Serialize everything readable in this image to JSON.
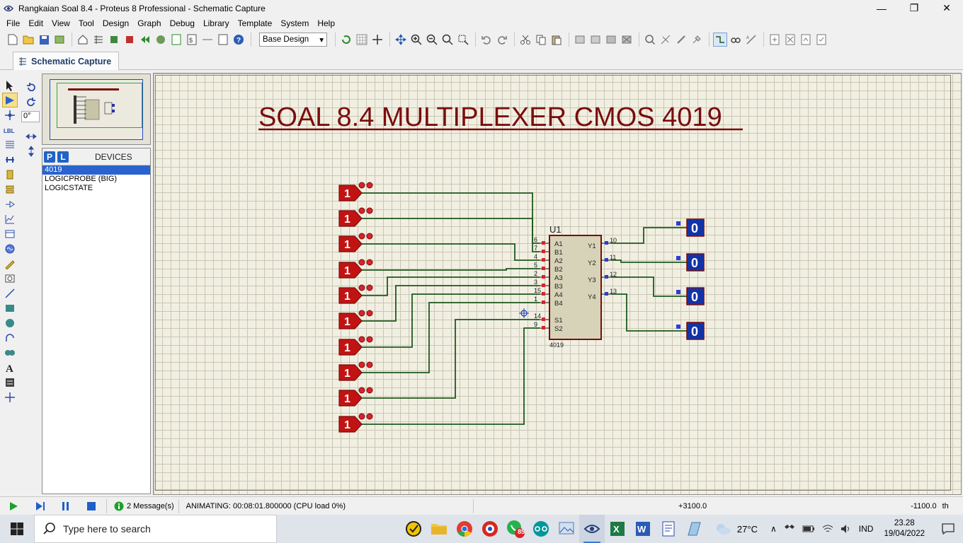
{
  "window": {
    "title": "Rangkaian Soal 8.4 - Proteus 8 Professional - Schematic Capture",
    "minimize": "—",
    "maximize": "❐",
    "close": "✕"
  },
  "menu": [
    "File",
    "Edit",
    "View",
    "Tool",
    "Design",
    "Graph",
    "Debug",
    "Library",
    "Template",
    "System",
    "Help"
  ],
  "toolbar": {
    "design_select": "Base Design"
  },
  "tab": {
    "label": "Schematic Capture"
  },
  "left_panel": {
    "angle": "0°",
    "devices_title": "DEVICES",
    "p_label": "P",
    "l_label": "L",
    "devices": [
      "4019",
      "LOGICPROBE (BIG)",
      "LOGICSTATE"
    ],
    "selected_device": "4019"
  },
  "schematic": {
    "title": "SOAL 8.4 MULTIPLEXER CMOS 4019",
    "chip_ref": "U1",
    "chip_part": "4019",
    "left_pins": [
      {
        "num": "6",
        "name": "A1"
      },
      {
        "num": "7",
        "name": "B1"
      },
      {
        "num": "4",
        "name": "A2"
      },
      {
        "num": "5",
        "name": "B2"
      },
      {
        "num": "2",
        "name": "A3"
      },
      {
        "num": "3",
        "name": "B3"
      },
      {
        "num": "15",
        "name": "A4"
      },
      {
        "num": "1",
        "name": "B4"
      },
      {
        "num": "14",
        "name": "S1"
      },
      {
        "num": "9",
        "name": "S2"
      }
    ],
    "right_pins": [
      {
        "num": "10",
        "name": "Y1"
      },
      {
        "num": "11",
        "name": "Y2"
      },
      {
        "num": "12",
        "name": "Y3"
      },
      {
        "num": "13",
        "name": "Y4"
      }
    ],
    "logic_states": [
      "1",
      "1",
      "1",
      "1",
      "1",
      "1",
      "1",
      "1",
      "1",
      "1"
    ],
    "probes": [
      "0",
      "0",
      "0",
      "0"
    ],
    "colors": {
      "title": "#7a0d0d",
      "wire": "#1f5a1f",
      "chip_fill": "#d6d3b8",
      "chip_border": "#7a0d0d",
      "logicstate": "#c21313",
      "probe": "#1233a8"
    }
  },
  "statusbar": {
    "messages": "2 Message(s)",
    "animating": "ANIMATING: 00:08:01.800000 (CPU load 0%)",
    "x_coord": "+3100.0",
    "y_coord": "-1100.0",
    "unit": "th"
  },
  "taskbar": {
    "search_placeholder": "Type here to search",
    "whatsapp_badge": "85",
    "weather": "27°C",
    "language": "IND",
    "time": "23.28",
    "date": "19/04/2022"
  }
}
